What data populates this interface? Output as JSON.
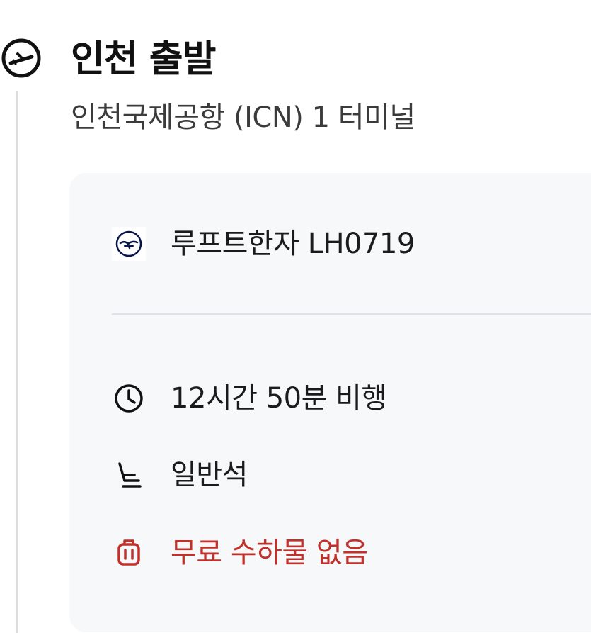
{
  "departure": {
    "title": "인천 출발",
    "airport": "인천국제공항 (ICN) 1 터미널",
    "icon": "airplane-takeoff-icon"
  },
  "segment": {
    "airline": {
      "label": "루프트한자 LH0719",
      "icon": "lufthansa-logo-icon",
      "brand_color": "#05164d"
    },
    "duration": {
      "label": "12시간 50분 비행",
      "icon": "clock-icon"
    },
    "cabin": {
      "label": "일반석",
      "icon": "seat-icon"
    },
    "baggage": {
      "label": "무료 수하물 없음",
      "icon": "luggage-icon",
      "color": "#c0312b"
    }
  },
  "colors": {
    "card_background": "#f7f8fa",
    "timeline": "#dddddd",
    "warning": "#c0312b"
  }
}
